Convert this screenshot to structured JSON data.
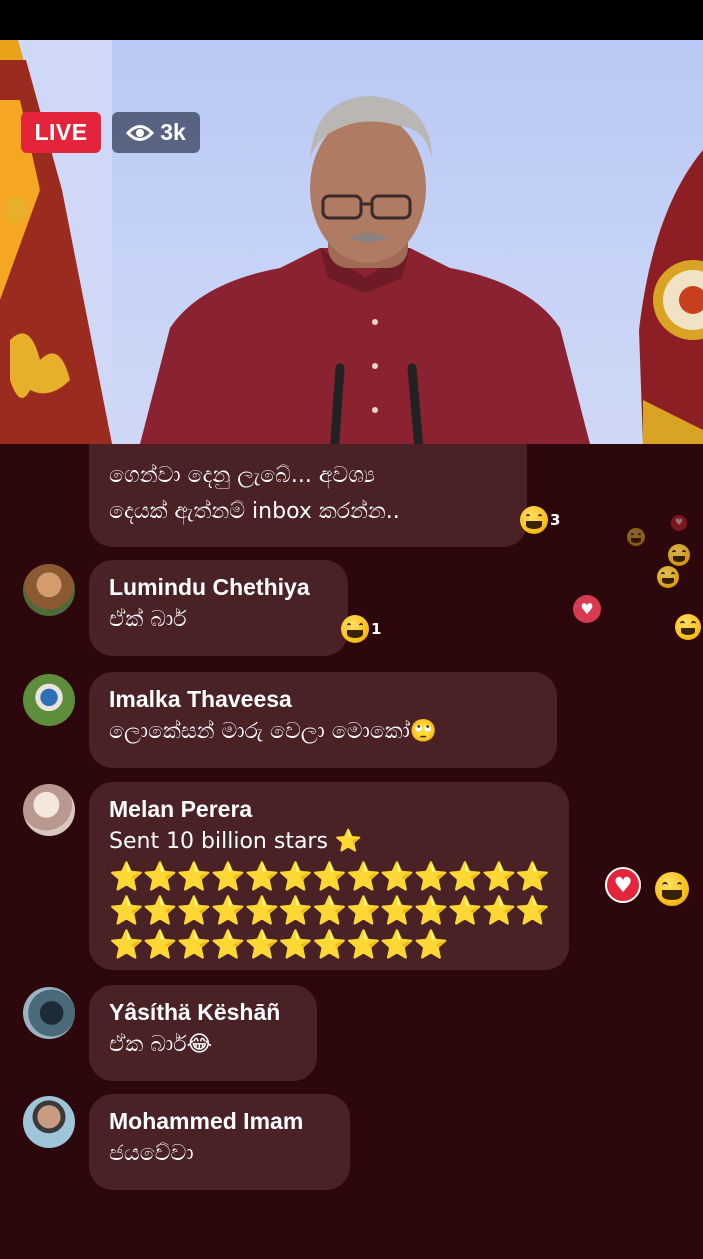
{
  "live": {
    "label": "LIVE",
    "viewers": "3k",
    "viewers_icon": "eye-icon"
  },
  "colors": {
    "live_badge": "#e4243b",
    "chat_bg": "#2c080c",
    "bubble_bg": "#4a2226",
    "star": "#ffcc1a"
  },
  "comments": [
    {
      "name": "",
      "lines": [
        "ගෙන්වා දෙනු ලැබේ... අවශ්‍ය",
        "දෙයක් ඇත්නම් inbox කරන්න.."
      ],
      "reaction": {
        "icon": "laughing-emoji-icon",
        "count": "3"
      }
    },
    {
      "name": "Lumindu Chethiya",
      "lines": [
        "ඒක් බාර්"
      ],
      "reaction": {
        "icon": "laughing-emoji-icon",
        "count": "1"
      }
    },
    {
      "name": "Imalka Thaveesa",
      "lines": [
        "ලොකේසන් මාරු වෙලා මොකෝ🙄"
      ]
    },
    {
      "name": "Melan Perera",
      "lines": [
        "Sent 10 billion stars ⭐"
      ],
      "stars": [
        "⭐⭐⭐⭐⭐⭐⭐⭐⭐⭐⭐⭐⭐",
        "⭐⭐⭐⭐⭐⭐⭐⭐⭐⭐⭐⭐⭐",
        "⭐⭐⭐⭐⭐⭐⭐⭐⭐⭐"
      ]
    },
    {
      "name": "Yâsíthä Këshāñ",
      "lines": [
        "ඒක බාර්😂"
      ]
    },
    {
      "name": "Mohammed Imam",
      "lines": [
        "ජයවේවා"
      ]
    }
  ],
  "floating_reactions": [
    "laughing-emoji-icon",
    "heart-icon"
  ]
}
